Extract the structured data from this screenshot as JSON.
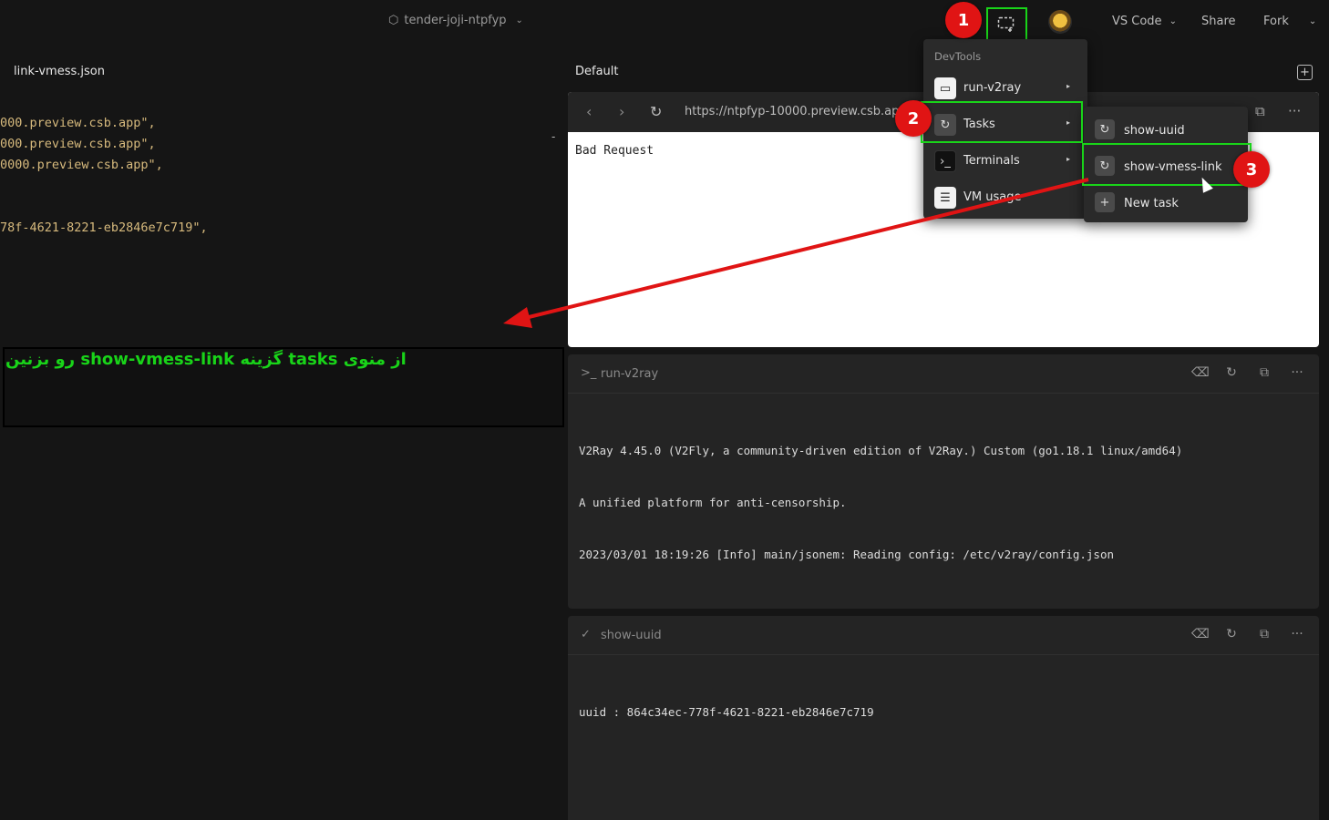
{
  "topbar": {
    "project_name": "tender-joji-ntpfyp",
    "vscode_label": "VS Code",
    "share_label": "Share",
    "fork_label": "Fork"
  },
  "editor": {
    "file_tab": "link-vmess.json",
    "lines": [
      "000.preview.csb.app\",",
      "000.preview.csb.app\",",
      "0000.preview.csb.app\",",
      "78f-4621-8221-eb2846e7c719\","
    ],
    "dash": "-"
  },
  "annotation": {
    "note": "از منوی tasks گزینه show-vmess-link رو بزنین",
    "steps": [
      "1",
      "2",
      "3"
    ],
    "highlight_color": "#19d419",
    "arrow_color": "#e01414"
  },
  "pane": {
    "title": "Default",
    "browser": {
      "url": "https://ntpfyp-10000.preview.csb.app/",
      "body": "Bad Request"
    },
    "terminals": [
      {
        "title": "run-v2ray",
        "lead": ">_",
        "lines": [
          "V2Ray 4.45.0 (V2Fly, a community-driven edition of V2Ray.) Custom (go1.18.1 linux/amd64)",
          "A unified platform for anti-censorship.",
          "2023/03/01 18:19:26 [Info] main/jsonem: Reading config: /etc/v2ray/config.json"
        ]
      },
      {
        "title": "show-uuid",
        "lead": "✓",
        "lines": [
          "uuid : 864c34ec-778f-4621-8221-eb2846e7c719"
        ]
      }
    ]
  },
  "devtools_menu": {
    "header": "DevTools",
    "items": [
      {
        "label": "run-v2ray",
        "icon": "browser-window-icon"
      },
      {
        "label": "Tasks",
        "icon": "refresh-icon"
      },
      {
        "label": "Terminals",
        "icon": "terminal-icon"
      },
      {
        "label": "VM usage",
        "icon": "server-icon"
      }
    ]
  },
  "tasks_submenu": {
    "items": [
      {
        "label": "show-uuid",
        "icon": "refresh-icon"
      },
      {
        "label": "show-vmess-link",
        "icon": "refresh-icon"
      },
      {
        "label": "New task",
        "icon": "plus-icon"
      }
    ]
  }
}
